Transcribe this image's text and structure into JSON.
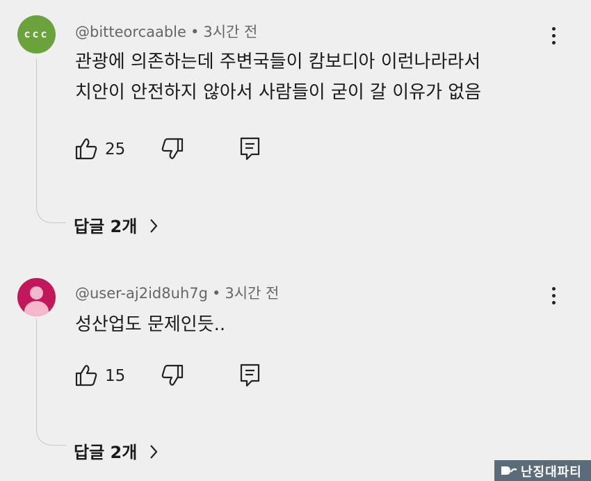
{
  "comments": [
    {
      "handle": "@bitteorcaable",
      "time": "3시간 전",
      "avatar_text": "ccc",
      "avatar_color": "#6aa33c",
      "text_lines": [
        "관광에 의존하는데 주변국들이 캄보디아 이런나라라서",
        "치안이 안전하지 않아서 사람들이 굳이 갈 이유가 없음"
      ],
      "likes": "25",
      "replies_label": "답글 2개"
    },
    {
      "handle": "@user-aj2id8uh7g",
      "time": "3시간 전",
      "avatar_color": "#c2185b",
      "text_lines": [
        "성산업도 문제인듯.."
      ],
      "likes": "15",
      "replies_label": "답글 2개"
    }
  ],
  "meta_separator": "•",
  "watermark": {
    "text": "난징대파티"
  },
  "icons": [
    "like-icon",
    "dislike-icon",
    "reply-icon",
    "more-options-icon",
    "chevron-right-icon"
  ]
}
